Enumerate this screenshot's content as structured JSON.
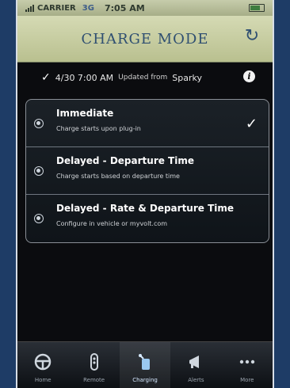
{
  "status": {
    "carrier": "CARRIER",
    "network": "3G",
    "time": "7:05 AM"
  },
  "header": {
    "title": "CHARGE MODE",
    "refresh_icon": "refresh-icon"
  },
  "update": {
    "check_icon": "checkmark-icon",
    "timestamp": "4/30 7:00 AM",
    "source_label": "Updated from",
    "source_name": "Sparky",
    "info_icon": "info-icon"
  },
  "options": [
    {
      "label": "Immediate",
      "description": "Charge starts upon plug-in",
      "selected": true
    },
    {
      "label": "Delayed - Departure Time",
      "description": "Charge starts based on departure time",
      "selected": false
    },
    {
      "label": "Delayed - Rate & Departure Time",
      "description": "Configure in vehicle or myvolt.com",
      "selected": false
    }
  ],
  "tabs": [
    {
      "label": "Home",
      "icon": "steering-wheel-icon"
    },
    {
      "label": "Remote",
      "icon": "key-fob-icon"
    },
    {
      "label": "Charging",
      "icon": "charging-plug-icon",
      "active": true
    },
    {
      "label": "Alerts",
      "icon": "megaphone-icon"
    },
    {
      "label": "More",
      "icon": "ellipsis-icon"
    }
  ],
  "colors": {
    "title": "#2f4f71",
    "header_bg": "#c9cf9f",
    "background": "#0b0c0f",
    "frame": "#1e3c66"
  }
}
